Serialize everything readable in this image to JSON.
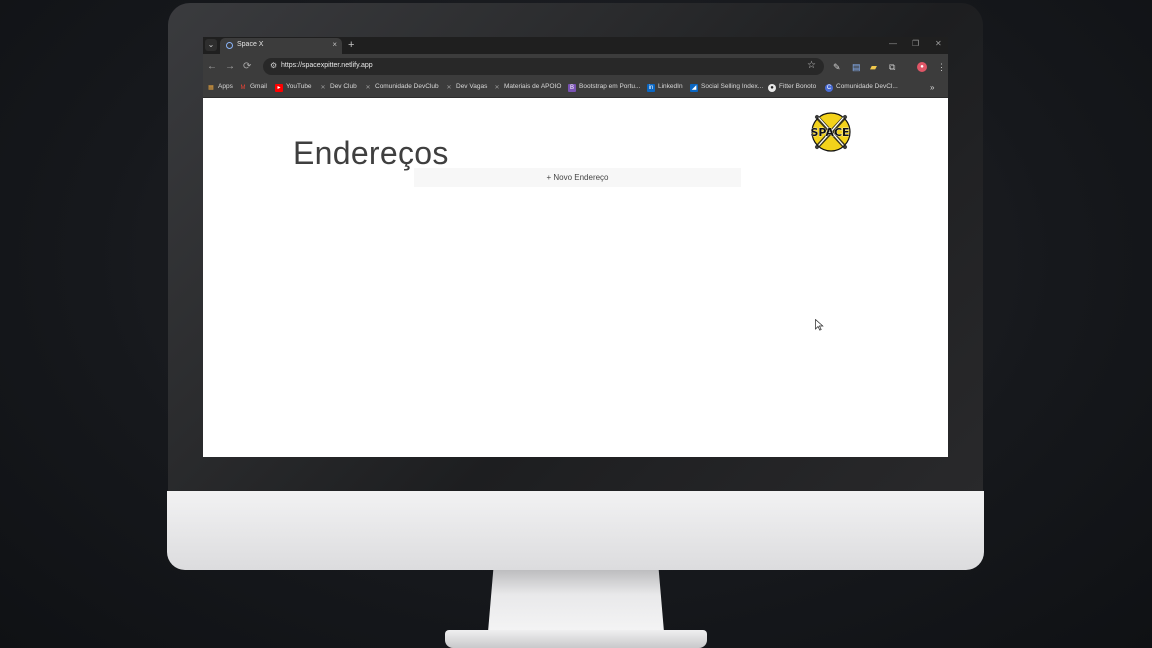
{
  "tab": {
    "title": "Space X",
    "close": "×",
    "new_tab": "+"
  },
  "nav": {
    "back": "←",
    "forward": "→",
    "reload": "⟳"
  },
  "address_bar": {
    "url": "https://spacexpitter.netlify.app"
  },
  "bookmarks": [
    {
      "label": "Apps",
      "icon": "apps-grid-icon"
    },
    {
      "label": "Gmail",
      "icon": "gmail-icon"
    },
    {
      "label": "YouTube",
      "icon": "youtube-icon"
    },
    {
      "label": "Dev Club",
      "icon": "devclub-icon"
    },
    {
      "label": "Comunidade DevClub",
      "icon": "devclub-icon"
    },
    {
      "label": "Dev Vagas",
      "icon": "devclub-icon"
    },
    {
      "label": "Materiais de APOIO",
      "icon": "devclub-icon"
    },
    {
      "label": "Bootstrap em Portu...",
      "icon": "bootstrap-icon"
    },
    {
      "label": "LinkedIn",
      "icon": "linkedin-icon"
    },
    {
      "label": "Social Selling Index...",
      "icon": "social-selling-icon"
    },
    {
      "label": "Fitter Bonoto",
      "icon": "github-icon"
    },
    {
      "label": "Comunidade DevCl...",
      "icon": "chrome-c-icon"
    }
  ],
  "bookmarks_overflow": "»",
  "page": {
    "title": "Endereços",
    "logo_text": "SPACE",
    "new_address_button": "+ Novo Endereço"
  }
}
